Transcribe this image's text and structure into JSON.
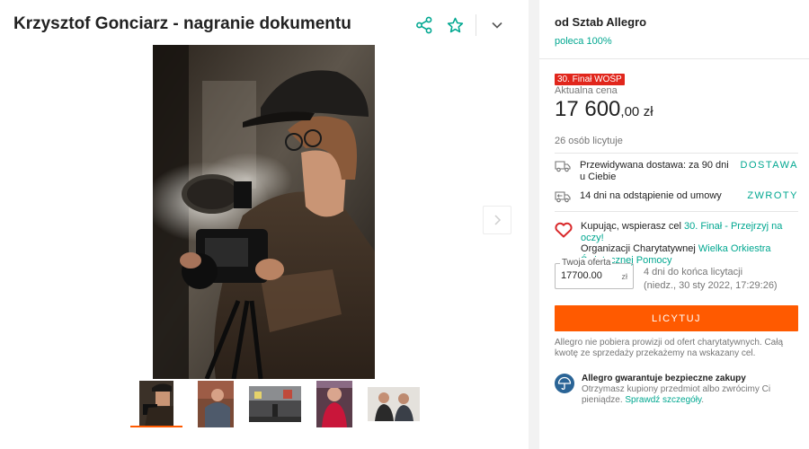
{
  "listing": {
    "title": "Krzysztof Gonciarz - nagranie dokumentu"
  },
  "colors": {
    "accent": "#ff5a00",
    "teal": "#00a790",
    "wosp_red": "#e1261c",
    "heart_red": "#d9292b"
  },
  "icons": {
    "share": "share-icon",
    "favorite": "star-icon",
    "more": "chevron-down-icon",
    "next": "chevron-right-icon",
    "delivery": "truck-icon",
    "return": "return-truck-icon",
    "charity": "heart-icon",
    "guarantee": "umbrella-icon"
  },
  "seller": {
    "name": "od Sztab Allegro",
    "recommendation": "poleca 100%"
  },
  "price": {
    "badge": "30. Finał WOŚP",
    "label": "Aktualna cena",
    "integer": "17 600",
    "decimal": ",00",
    "currency": "zł"
  },
  "bidders": "26 osób licytuje",
  "delivery": {
    "text_line1": "Przewidywana dostawa: za 90 dni",
    "text_line2": "u Ciebie",
    "link": "DOSTAWA"
  },
  "returns": {
    "text": "14 dni na odstąpienie od umowy",
    "link": "ZWROTY"
  },
  "charity": {
    "text_before": "Kupując, wspierasz cel",
    "cause_link": "30. Finał - Przejrzyj na oczy!",
    "org_prefix": "Organizacji Charytatywnej",
    "org_link_line1": "Wielka Orkiestra",
    "org_link_line2": "Świątecznej Pomocy"
  },
  "bid": {
    "label": "Twoja oferta",
    "value": "17700.00",
    "currency": "zł",
    "time_left": "4 dni do końca licytacji",
    "end_date": "(niedz., 30 sty 2022, 17:29:26)",
    "button": "LICYTUJ"
  },
  "fee_note": {
    "line1": "Allegro nie pobiera prowizji od ofert charytatywnych. Całą",
    "line2": "kwotę ze sprzedaży przekażemy na wskazany cel."
  },
  "guarantee": {
    "title": "Allegro gwarantuje bezpieczne zakupy",
    "line1": "Otrzymasz kupiony przedmiot albo zwrócimy Ci",
    "line2_prefix": "pieniądze.",
    "link": "Sprawdź szczegóły",
    "line2_suffix": "."
  }
}
